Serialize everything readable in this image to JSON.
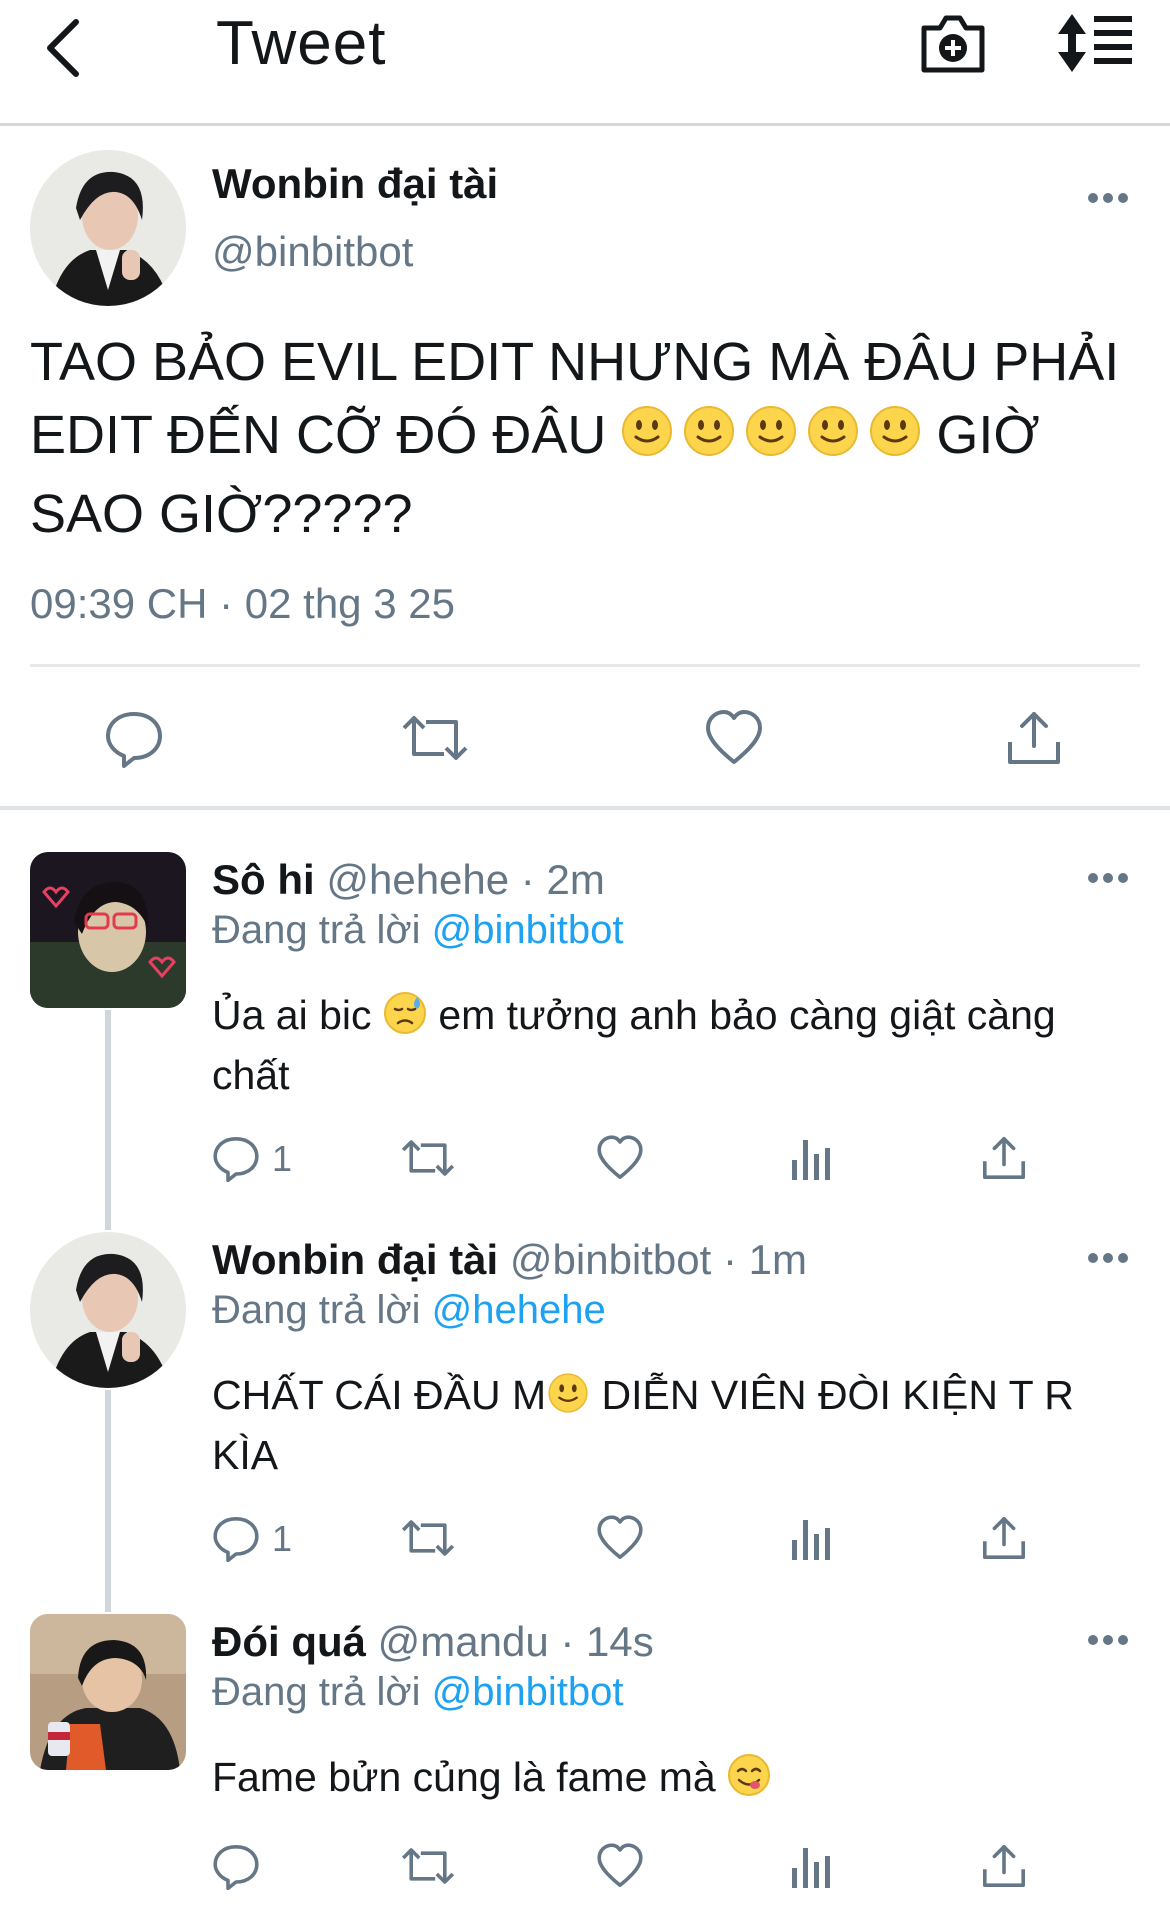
{
  "header": {
    "title": "Tweet"
  },
  "main_tweet": {
    "name": "Wonbin đại tài",
    "handle": "@binbitbot",
    "text_line1": "TAO BẢO EVIL EDIT NHƯNG MÀ ĐÂU PHẢI",
    "text_line2_a": "EDIT ĐẾN CỠ ĐÓ ĐÂU",
    "text_line2_b": "GIỜ",
    "text_line3": "SAO GIỜ?????",
    "timestamp": "09:39 CH · 02 thg 3 25"
  },
  "replies": [
    {
      "name": "Sô hi",
      "meta": "@hehehe · 2m",
      "replying_label": "Đang trả lời",
      "replying_to": "@binbitbot",
      "text_a": "Ủa ai bic",
      "text_b": "em tưởng anh bảo càng giật càng chất",
      "reply_count": "1"
    },
    {
      "name": "Wonbin đại tài",
      "meta": "@binbitbot · 1m",
      "replying_label": "Đang trả lời",
      "replying_to": "@hehehe",
      "text_a": "CHẤT CÁI ĐẦU M",
      "text_b": "DIỄN VIÊN ĐÒI KIỆN T R KÌA",
      "reply_count": "1"
    },
    {
      "name": "Đói quá",
      "meta": "@mandu · 14s",
      "replying_label": "Đang trả lời",
      "replying_to": "@binbitbot",
      "text_a": "Fame bửn củng là fame mà",
      "reply_count": ""
    }
  ],
  "colors": {
    "link": "#1da1f2",
    "secondary_text": "#657786",
    "icon": "#657786"
  }
}
